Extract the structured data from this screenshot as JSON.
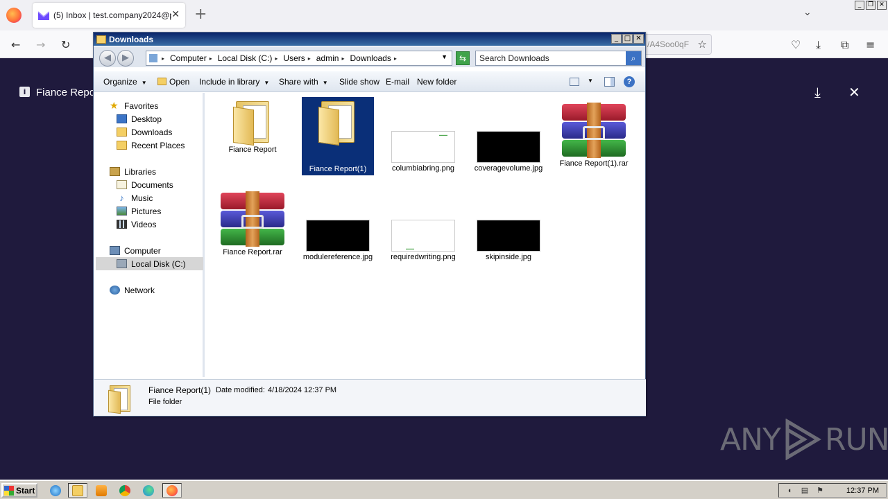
{
  "browser": {
    "tab_title": "(5) Inbox | test.company2024@pr",
    "tab_close": "✕",
    "new_tab": "+",
    "url_fragment": "/A4Soo0qF",
    "window_controls": [
      "_",
      "❐",
      "✕"
    ]
  },
  "page": {
    "attachment_name": "Fiance Repor",
    "download_icon": "⤓",
    "close_icon": "✕"
  },
  "watermark": {
    "left": "ANY",
    "right": "RUN"
  },
  "explorer": {
    "title": "Downloads",
    "window_controls": [
      "_",
      "□",
      "✕"
    ],
    "breadcrumbs": [
      "Computer",
      "Local Disk (C:)",
      "Users",
      "admin",
      "Downloads"
    ],
    "search_placeholder": "Search Downloads",
    "toolbar": {
      "organize": "Organize",
      "open": "Open",
      "include_in_library": "Include in library",
      "share_with": "Share with",
      "slide_show": "Slide show",
      "email": "E-mail",
      "new_folder": "New folder"
    },
    "nav": {
      "favorites": "Favorites",
      "desktop": "Desktop",
      "downloads": "Downloads",
      "recent_places": "Recent Places",
      "libraries": "Libraries",
      "documents": "Documents",
      "music": "Music",
      "pictures": "Pictures",
      "videos": "Videos",
      "computer": "Computer",
      "local_disk": "Local Disk (C:)",
      "network": "Network"
    },
    "files": [
      {
        "name": "Fiance Report",
        "type": "folder"
      },
      {
        "name": "Fiance Report(1)",
        "type": "folder",
        "selected": true
      },
      {
        "name": "columbiabring.png",
        "type": "image-white"
      },
      {
        "name": "coveragevolume.jpg",
        "type": "image-black"
      },
      {
        "name": "Fiance Report(1).rar",
        "type": "rar"
      },
      {
        "name": "Fiance Report.rar",
        "type": "rar"
      },
      {
        "name": "modulereference.jpg",
        "type": "image-black"
      },
      {
        "name": "requiredwriting.png",
        "type": "image-white"
      },
      {
        "name": "skipinside.jpg",
        "type": "image-black"
      }
    ],
    "details": {
      "name": "Fiance Report(1)",
      "date_label": "Date modified:",
      "date_value": "4/18/2024 12:37 PM",
      "type": "File folder"
    }
  },
  "taskbar": {
    "start_label": "Start",
    "clock": "12:37 PM"
  }
}
